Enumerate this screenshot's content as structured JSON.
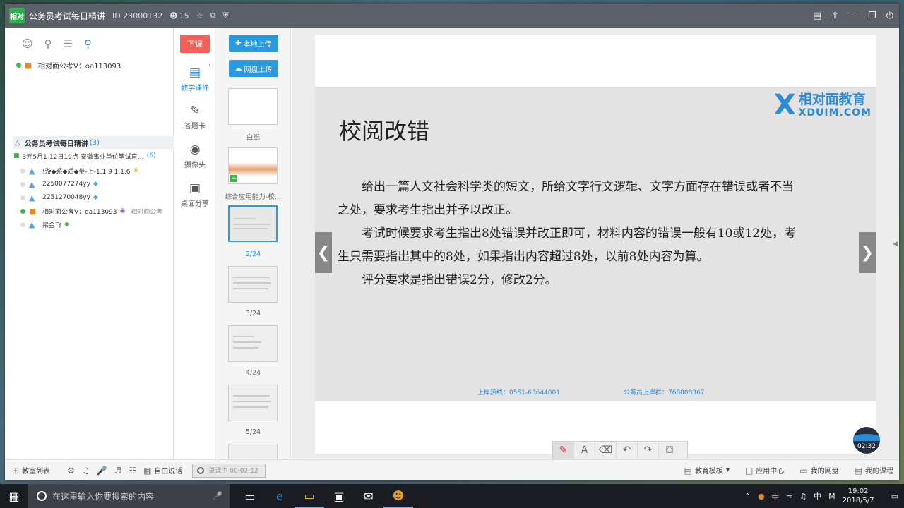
{
  "window": {
    "title": "公务员考试每日精讲",
    "id_label": "ID 23000132",
    "online_count": "15",
    "logo_text": "相对"
  },
  "left_panel": {
    "teacher": "相对面公考V：oa113093",
    "group_title": "公务员考试每日精讲",
    "group_count": "(3)",
    "subgroup_title": "3元5月1-12日19点 安徽事业单位笔试直…",
    "subgroup_count": "(6)",
    "members": [
      {
        "name": "!游◆系◆质◆坐-上-1.1 9 1.1.6"
      },
      {
        "name": "2250077274yy"
      },
      {
        "name": "2251270048yy"
      },
      {
        "name": "相对面公考V：oa113093",
        "note": "相对面公考"
      },
      {
        "name": "梁金飞"
      }
    ]
  },
  "tools": {
    "end_class": "下课",
    "courseware": "教学课件",
    "answer_card": "答题卡",
    "camera": "摄像头",
    "desktop_share": "桌面分享"
  },
  "slides_panel": {
    "local_upload": "本地上传",
    "cloud_upload": "网盘上传",
    "thumbs": [
      {
        "label": "白纸"
      },
      {
        "label": "综合应用能力-校…"
      },
      {
        "label": "2/24"
      },
      {
        "label": "3/24"
      },
      {
        "label": "4/24"
      },
      {
        "label": "5/24"
      }
    ]
  },
  "slide": {
    "title": "校阅改错",
    "brand_cn": "相对面教育",
    "brand_en": "XDUIM.COM",
    "paragraphs": [
      "给出一篇人文社会科学类的短文，所给文字行文逻辑、文字方面存在错误或者不当之处，要求考生指出并予以改正。",
      "考试时候要求考生指出8处错误并改正即可，材料内容的错误一般有10或12处，考生只需要指出其中的8处，如果指出内容超过8处，以前8处内容为算。",
      "评分要求是指出错误2分，修改2分。"
    ],
    "footer_hotline": "上岸热线：0551-63644001",
    "footer_group": "公务员上岸群：768808367"
  },
  "timer": "02:32",
  "bottom_bar": {
    "classroom_list": "教室列表",
    "free_talk": "自由说话",
    "record": "录课中 00:02:12",
    "template": "教育模板",
    "app_center": "应用中心",
    "my_disk": "我的网盘",
    "my_course": "我的课程"
  },
  "taskbar": {
    "search_placeholder": "在这里输入你要搜索的内容",
    "ime": "中",
    "time": "19:02",
    "date": "2018/5/7"
  }
}
